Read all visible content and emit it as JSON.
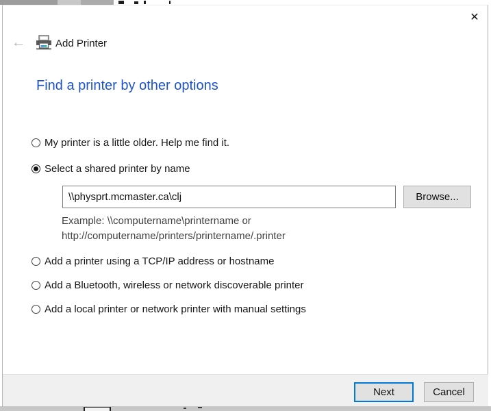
{
  "window": {
    "close_icon": "✕",
    "back_icon": "←"
  },
  "header": {
    "title": "Add Printer"
  },
  "heading": {
    "text": "Find a printer by other options"
  },
  "options": [
    {
      "id": "older",
      "label": "My printer is a little older. Help me find it.",
      "selected": false
    },
    {
      "id": "shared",
      "label": "Select a shared printer by name",
      "selected": true
    },
    {
      "id": "tcpip",
      "label": "Add a printer using a TCP/IP address or hostname",
      "selected": false
    },
    {
      "id": "bluetooth",
      "label": "Add a Bluetooth, wireless or network discoverable printer",
      "selected": false
    },
    {
      "id": "local",
      "label": "Add a local printer or network printer with manual settings",
      "selected": false
    }
  ],
  "shared_printer": {
    "input_value": "\\\\physprt.mcmaster.ca\\clj",
    "browse_label": "Browse...",
    "example_line1": "Example: \\\\computername\\printername or",
    "example_line2": "http://computername/printers/printername/.printer"
  },
  "footer": {
    "next_label": "Next",
    "cancel_label": "Cancel"
  },
  "colors": {
    "heading_blue": "#1d52c8",
    "focus_blue": "#0078d7",
    "button_bg": "#e1e1e1",
    "button_border": "#adadad",
    "footer_bg": "#f0f0f0",
    "input_border": "#7a7a7a",
    "printer_icon_accent_teal": "#2fb1a6",
    "printer_icon_accent_blue": "#3b8de0"
  }
}
